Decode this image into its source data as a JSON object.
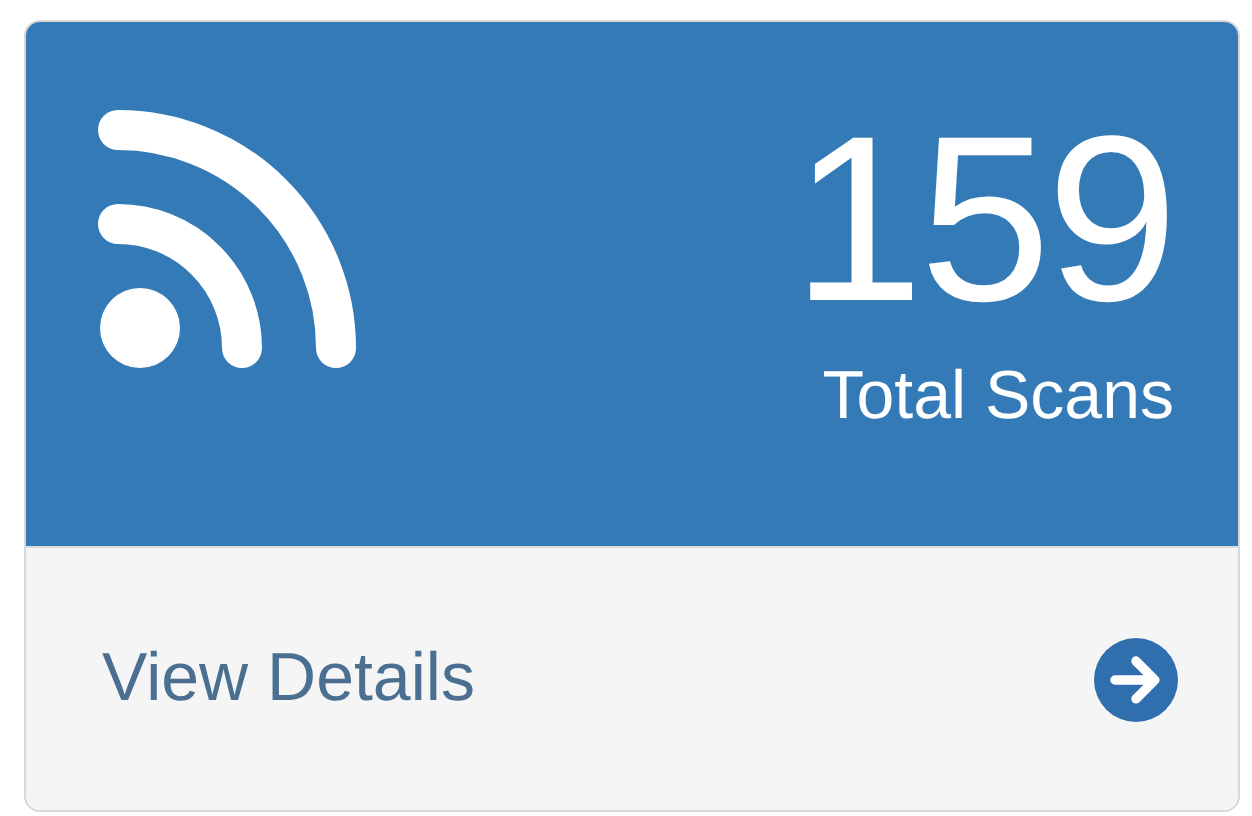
{
  "panel": {
    "count": "159",
    "label": "Total Scans"
  },
  "footer": {
    "link": "View Details"
  }
}
